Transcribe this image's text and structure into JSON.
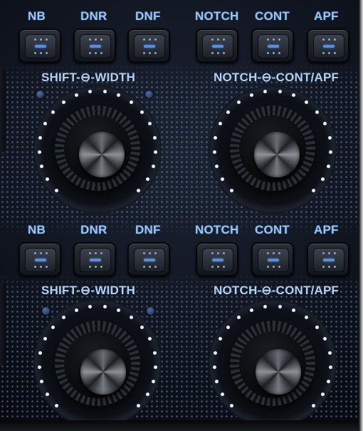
{
  "upper": {
    "buttons": [
      "NB",
      "DNR",
      "DNF",
      "NOTCH",
      "CONT",
      "APF"
    ],
    "knob_left": {
      "label_a": "SHIFT",
      "label_b": "WIDTH"
    },
    "knob_right": {
      "label_a": "NOTCH",
      "label_b": "CONT/APF"
    }
  },
  "lower": {
    "buttons": [
      "NB",
      "DNR",
      "DNF",
      "NOTCH",
      "CONT",
      "APF"
    ],
    "knob_left": {
      "label_a": "SHIFT",
      "label_b": "WIDTH"
    },
    "knob_right": {
      "label_a": "NOTCH",
      "label_b": "CONT/APF"
    }
  },
  "colors": {
    "panel": "#101520",
    "label_blue": "#9dc4f0",
    "led_blue": "#5d8cd9",
    "tick_white": "#e8eef8"
  },
  "icons": [
    "knob-link-icon"
  ]
}
